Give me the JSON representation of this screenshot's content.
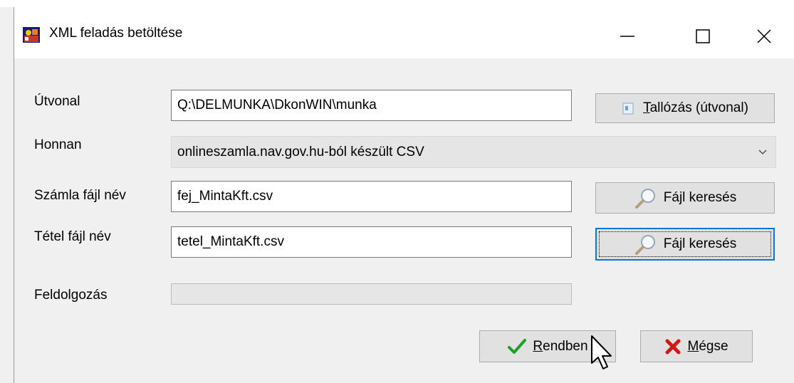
{
  "window": {
    "title": "XML feladás betöltése",
    "icons": {
      "app": "app-logo-icon",
      "minimize": "minimize-icon",
      "maximize": "maximize-icon",
      "close": "close-icon"
    }
  },
  "form": {
    "path_label": "Útvonal",
    "path_value": "Q:\\DELMUNKA\\DkonWIN\\munka",
    "browse_path_prefix": "T",
    "browse_path_rest": "allózás (útvonal)",
    "source_label": "Honnan",
    "source_value": "onlineszamla.nav.gov.hu-ból készült CSV",
    "invoice_file_label": "Számla fájl név",
    "invoice_file_value": "fej_MintaKft.csv",
    "invoice_search_label": "Fájl keresés",
    "item_file_label": "Tétel fájl név",
    "item_file_value": "tetel_MintaKft.csv",
    "item_search_label": "Fájl keresés",
    "processing_label": "Feldolgozás",
    "processing_progress": 0
  },
  "actions": {
    "ok_prefix": "R",
    "ok_rest": "endben",
    "cancel_prefix": "M",
    "cancel_rest": "égse"
  },
  "colors": {
    "accent": "#0078d7",
    "ok_check": "#1e9e2a",
    "cancel_x": "#d01818"
  }
}
